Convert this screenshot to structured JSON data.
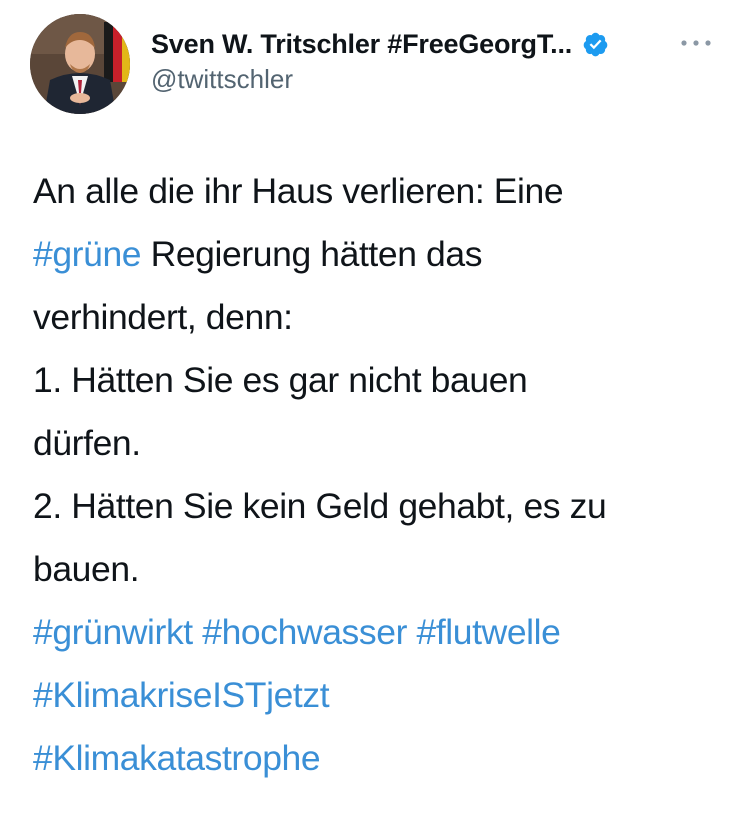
{
  "user": {
    "display_name": "Sven W. Tritschler #FreeGeorgT...",
    "handle": "@twittschler",
    "verified": true
  },
  "icons": {
    "verified": "verified-badge-icon",
    "more": "more-options-icon"
  },
  "colors": {
    "hashtag": "#3a8fd6",
    "text": "#0f1419",
    "handle": "#536471",
    "verified": "#1d9bf0"
  },
  "tweet": {
    "line1": "An alle die ihr Haus verlieren: Eine",
    "line2_tag": "#grüne",
    "line2_rest": " Regierung hätten das",
    "line3": "verhindert, denn:",
    "line4": "1. Hätten Sie es gar nicht bauen",
    "line5": "dürfen.",
    "line6": "2. Hätten Sie kein Geld gehabt, es zu",
    "line7": "bauen.",
    "hashtags_line1": [
      "#grünwirkt",
      "#hochwasser",
      "#flutwelle"
    ],
    "hashtag_klimakrise": "#KlimakriseISTjetzt",
    "hashtag_klimakatastrophe": "#Klimakatastrophe"
  }
}
